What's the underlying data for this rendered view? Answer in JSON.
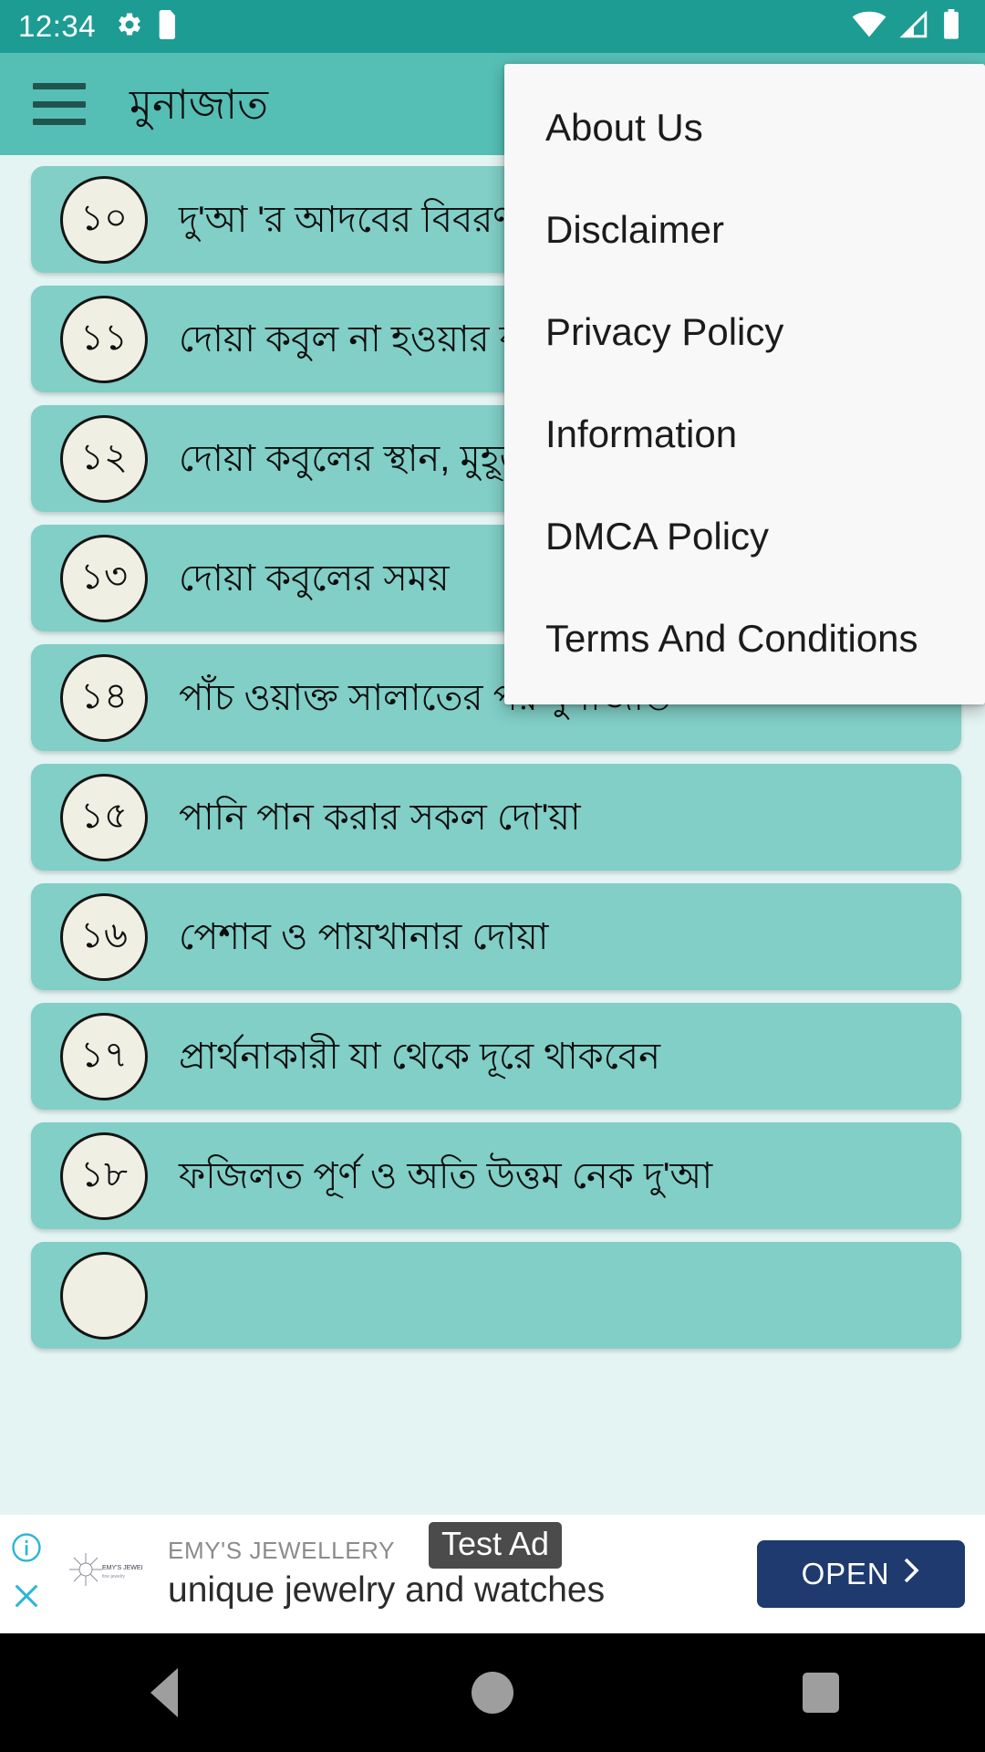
{
  "status_bar": {
    "clock": "12:34",
    "left_icons": [
      "gear-icon",
      "sd-card-icon"
    ],
    "right_icons": [
      "wifi-icon",
      "cellular-signal-icon",
      "battery-icon"
    ],
    "background_color": "#1d9c93"
  },
  "app_bar": {
    "menu_icon": "hamburger-menu-icon",
    "title": "মুনাজাত",
    "background_color": "#56bfb5"
  },
  "overflow_menu": {
    "items": [
      {
        "label": "About Us"
      },
      {
        "label": "Disclaimer"
      },
      {
        "label": "Privacy Policy"
      },
      {
        "label": "Information"
      },
      {
        "label": "DMCA Policy"
      },
      {
        "label": "Terms And Conditions"
      }
    ],
    "background_color": "#f8f8f8"
  },
  "list": {
    "card_color": "#81cfc7",
    "badge_color": "#efefe3",
    "items": [
      {
        "number": "১০",
        "title": "দু'আ 'র আদবের বিবরণ"
      },
      {
        "number": "১১",
        "title": "দোয়া কবুল না হওয়ার কারণ"
      },
      {
        "number": "১২",
        "title": "দোয়া কবুলের স্থান, মুহূর্ত"
      },
      {
        "number": "১৩",
        "title": "দোয়া কবুলের সময়"
      },
      {
        "number": "১৪",
        "title": "পাঁচ ওয়াক্ত সালাতের পর মুনাজাত"
      },
      {
        "number": "১৫",
        "title": "পানি পান করার সকল দো'য়া"
      },
      {
        "number": "১৬",
        "title": "পেশাব ও পায়খানার দোয়া"
      },
      {
        "number": "১৭",
        "title": "প্রার্থনাকারী যা থেকে দূরে থাকবেন"
      },
      {
        "number": "১৮",
        "title": "ফজিলত পূর্ণ ও অতি উত্তম নেক দু'আ"
      }
    ]
  },
  "ad_banner": {
    "info_icon": "ad-info-icon",
    "close_icon": "ad-close-icon",
    "logo_icon": "advertiser-logo-icon",
    "advertiser": "EMY'S JEWELLERY",
    "headline": "unique jewelry and watches",
    "test_label": "Test Ad",
    "cta_label": "OPEN",
    "cta_icon": "chevron-right-icon",
    "cta_color": "#1e3a6e"
  },
  "nav_bar": {
    "back_icon": "triangle-back-icon",
    "home_icon": "circle-home-icon",
    "recents_icon": "square-recents-icon",
    "background_color": "#000000"
  }
}
